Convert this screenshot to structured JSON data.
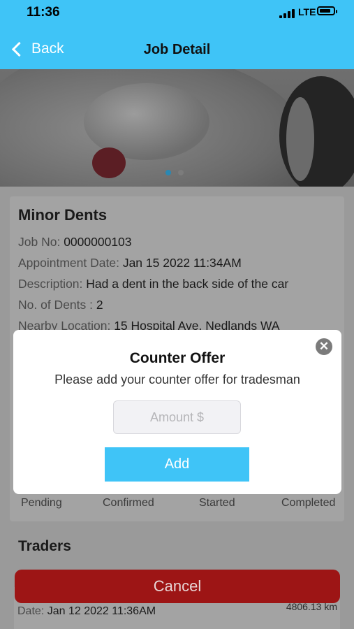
{
  "status_bar": {
    "time": "11:36",
    "network": "LTE"
  },
  "nav": {
    "back_label": "Back",
    "title": "Job Detail"
  },
  "colors": {
    "accent": "#3fc4f7",
    "cancel": "#9d1515",
    "page_dim": "#9a9a9a"
  },
  "carousel": {
    "dot_count": 2,
    "active_index": 0
  },
  "job": {
    "title": "Minor Dents",
    "job_no_label": "Job No:",
    "job_no": "0000000103",
    "appointment_label": "Appointment Date:",
    "appointment": "Jan 15 2022 11:34AM",
    "description_label": "Description:",
    "description": "Had a dent in the back side of the car",
    "dents_label": "No. of Dents :",
    "dents": "2",
    "location_label": "Nearby Location:",
    "location": "15 Hospital Ave, Nedlands WA"
  },
  "status_steps": [
    "Pending",
    "Confirmed",
    "Started",
    "Completed"
  ],
  "traders": {
    "heading": "Traders",
    "date_label": "Date:",
    "date": "Jan 12 2022 11:36AM",
    "distance": "4806.13 km"
  },
  "cancel_label": "Cancel",
  "modal": {
    "title": "Counter Offer",
    "subtitle": "Please add your counter offer for tradesman",
    "amount_placeholder": "Amount $",
    "amount_value": "",
    "add_label": "Add",
    "close_icon": "close-circle-icon"
  }
}
